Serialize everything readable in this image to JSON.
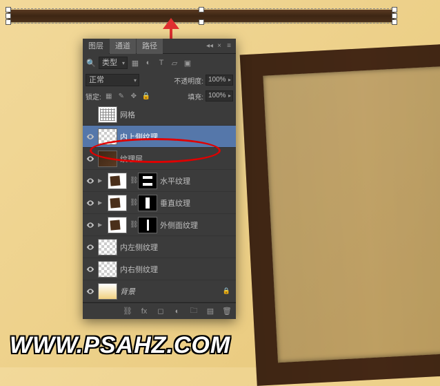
{
  "watermark": "WWW.PSAHZ.COM",
  "panel": {
    "tabs": [
      "图层",
      "通道",
      "路径"
    ],
    "filter": {
      "label": "类型",
      "icons": [
        "image",
        "fx",
        "text",
        "shape",
        "smart"
      ]
    },
    "blend": {
      "mode": "正常",
      "opacity_label": "不透明度:",
      "opacity": "100%"
    },
    "lock": {
      "label": "锁定:",
      "fill_label": "填充:",
      "fill": "100%"
    },
    "layers": [
      {
        "name": "网格",
        "visible": false,
        "thumb": "grid"
      },
      {
        "name": "内上侧纹理",
        "visible": true,
        "thumb": "checker",
        "selected": true
      },
      {
        "name": "纹理层",
        "visible": true,
        "thumb": "wood"
      },
      {
        "name": "水平纹理",
        "visible": true,
        "thumb": "frame",
        "mask": "h",
        "group": true
      },
      {
        "name": "垂直纹理",
        "visible": true,
        "thumb": "frame",
        "mask": "v",
        "group": true
      },
      {
        "name": "外侧面纹理",
        "visible": true,
        "thumb": "frame",
        "mask": "side",
        "group": true
      },
      {
        "name": "内左侧纹理",
        "visible": true,
        "thumb": "checker"
      },
      {
        "name": "内右侧纹理",
        "visible": true,
        "thumb": "checker"
      },
      {
        "name": "背景",
        "visible": true,
        "thumb": "gradient",
        "locked": true,
        "italic": true
      }
    ]
  }
}
